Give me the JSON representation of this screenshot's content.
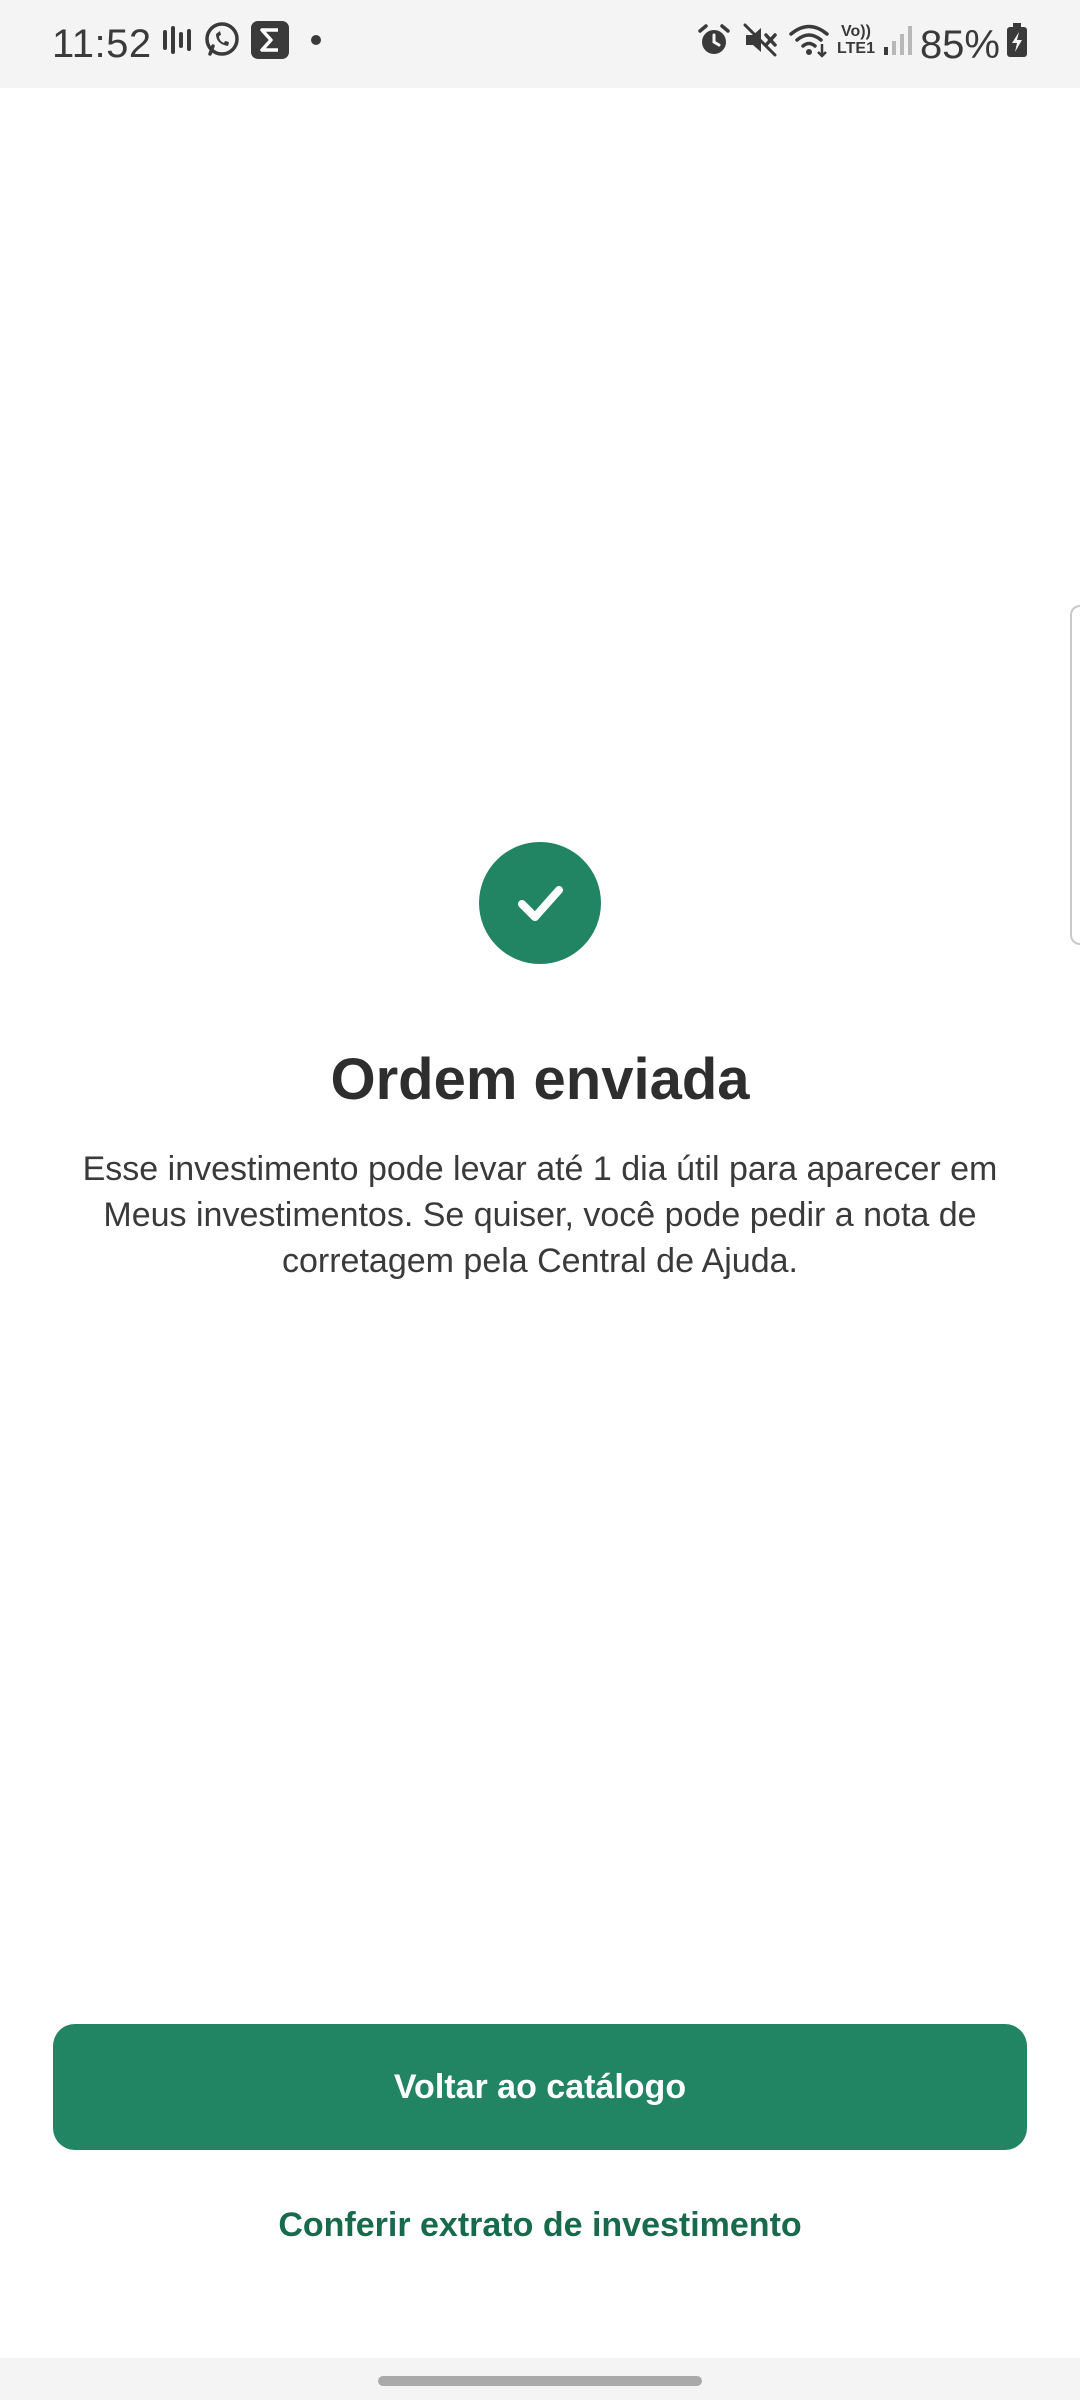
{
  "status_bar": {
    "time": "11:52",
    "battery": "85%",
    "network_label": "Vo)) LTE1",
    "left_icons": [
      "soundwave-icon",
      "whatsapp-icon",
      "sigma-app-icon",
      "dot-icon"
    ],
    "right_icons": [
      "alarm-icon",
      "mute-icon",
      "wifi-icon",
      "lte-icon",
      "signal-icon",
      "battery-charging-icon"
    ]
  },
  "content": {
    "icon": "checkmark-circle-icon",
    "title": "Ordem enviada",
    "message": "Esse investimento pode levar até 1 dia útil para aparecer em Meus investimentos. Se quiser, você pode pedir a nota de corretagem pela Central de Ajuda."
  },
  "actions": {
    "primary_label": "Voltar ao catálogo",
    "secondary_label": "Conferir extrato de investimento"
  },
  "colors": {
    "brand": "#218563",
    "link": "#176b4c",
    "status_bar_bg": "#f4f4f4"
  }
}
